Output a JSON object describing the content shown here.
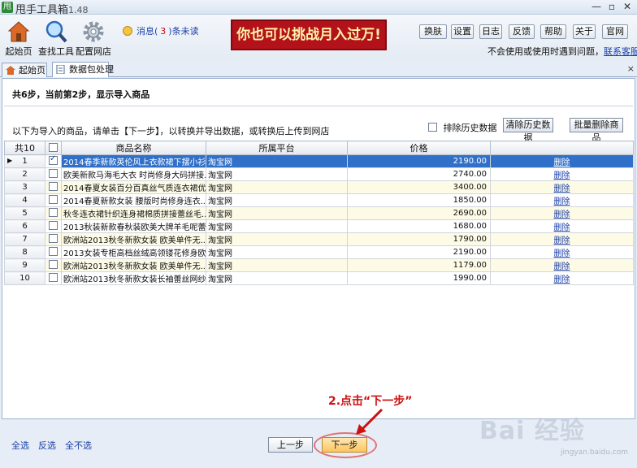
{
  "window": {
    "app_icon_text": "甩",
    "title": "甩手工具箱",
    "version": "1.48",
    "min": "—",
    "restore": "▫",
    "close": "✕"
  },
  "toolbar": {
    "home": "起始页",
    "find_tools": "查找工具",
    "config_shop": "配置网店",
    "message_prefix": "消息(",
    "message_count": "3",
    "message_suffix": ")条未读",
    "banner": "你也可以挑战月入过万!",
    "buttons": [
      "换肤",
      "设置",
      "日志",
      "反馈",
      "帮助",
      "关于",
      "官网"
    ],
    "help_text": "不会使用或使用时遇到问题，",
    "help_link": "联系客服"
  },
  "tabs": [
    {
      "label": "起始页",
      "icon": "home-icon"
    },
    {
      "label": "数据包处理",
      "icon": "document-icon"
    }
  ],
  "tab_close": "×",
  "content": {
    "step_text": "共6步，当前第2步，显示导入商品",
    "intro": "以下为导入的商品，请单击【下一步】，以转换并导出数据，或转换后上传到网店",
    "exclude_history": "排除历史数据",
    "clear_history": "清除历史数据",
    "batch_delete": "批量删除商品"
  },
  "grid": {
    "count_header": "共10",
    "columns": [
      "商品名称",
      "所属平台",
      "价格"
    ],
    "rows": [
      {
        "no": "1",
        "checked": true,
        "name": "2014春季新款英伦风上衣款裙下摆小衫...",
        "platform": "淘宝网",
        "price": "2190.00",
        "action": "删除"
      },
      {
        "no": "2",
        "checked": false,
        "name": "欧美新款马海毛大衣 时尚修身大码拼接...",
        "platform": "淘宝网",
        "price": "2740.00",
        "action": "删除"
      },
      {
        "no": "3",
        "checked": false,
        "name": "2014春夏女装百分百真丝气质连衣裙优...",
        "platform": "淘宝网",
        "price": "3400.00",
        "action": "删除"
      },
      {
        "no": "4",
        "checked": false,
        "name": "2014春夏新款女装 腰版时尚修身连衣...",
        "platform": "淘宝网",
        "price": "1850.00",
        "action": "删除"
      },
      {
        "no": "5",
        "checked": false,
        "name": "秋冬连衣裙针织连身裙棉质拼接蕾丝毛...",
        "platform": "淘宝网",
        "price": "2690.00",
        "action": "删除"
      },
      {
        "no": "6",
        "checked": false,
        "name": "2013秋装新款春秋装欧美大牌羊毛呢蕾...",
        "platform": "淘宝网",
        "price": "1680.00",
        "action": "删除"
      },
      {
        "no": "7",
        "checked": false,
        "name": "欧洲站2013秋冬新款女装 欧美单件无...",
        "platform": "淘宝网",
        "price": "1790.00",
        "action": "删除"
      },
      {
        "no": "8",
        "checked": false,
        "name": "2013女装专柜高档丝绒高领镂花修身欧...",
        "platform": "淘宝网",
        "price": "2190.00",
        "action": "删除"
      },
      {
        "no": "9",
        "checked": false,
        "name": "欧洲站2013秋冬新款女装 欧美单件无...",
        "platform": "淘宝网",
        "price": "1179.00",
        "action": "删除"
      },
      {
        "no": "10",
        "checked": false,
        "name": "欧洲站2013秋冬新款女装长袖蕾丝网纱...",
        "platform": "淘宝网",
        "price": "1990.00",
        "action": "删除"
      }
    ]
  },
  "bottom": {
    "select_all": "全选",
    "invert": "反选",
    "select_none": "全不选",
    "prev": "上一步",
    "next": "下一步"
  },
  "annotation": "2.点击“下一步”",
  "watermark": "Bai 经验",
  "watermark_sub": "jingyan.baidu.com",
  "colors": {
    "banner": "#b3121a",
    "selected_row": "#3170c9",
    "annotation": "#cc1111"
  }
}
